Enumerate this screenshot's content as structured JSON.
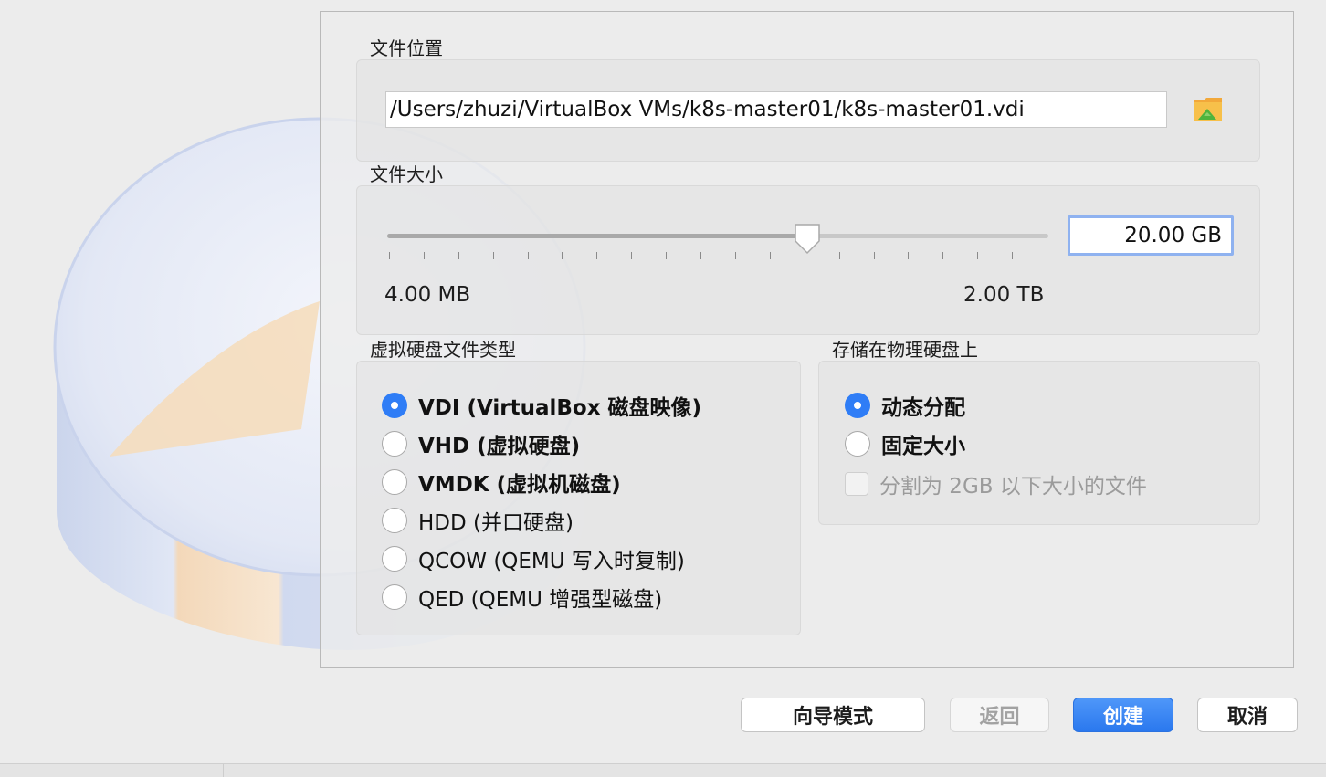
{
  "location": {
    "label": "文件位置",
    "path": "/Users/zhuzi/VirtualBox VMs/k8s-master01/k8s-master01.vdi",
    "browse_icon": "folder-browse-icon"
  },
  "size": {
    "label": "文件大小",
    "value": "20.00 GB",
    "min_label": "4.00 MB",
    "max_label": "2.00 TB",
    "slider_fraction": 0.635
  },
  "disk_type": {
    "label": "虚拟硬盘文件类型",
    "options": [
      {
        "label": "VDI (VirtualBox 磁盘映像)",
        "checked": true
      },
      {
        "label": "VHD (虚拟硬盘)",
        "checked": false
      },
      {
        "label": "VMDK (虚拟机磁盘)",
        "checked": false
      },
      {
        "label": "HDD (并口硬盘)",
        "checked": false
      },
      {
        "label": "QCOW (QEMU 写入时复制)",
        "checked": false
      },
      {
        "label": "QED (QEMU 增强型磁盘)",
        "checked": false
      }
    ]
  },
  "storage": {
    "label": "存储在物理硬盘上",
    "options": [
      {
        "label": "动态分配",
        "checked": true
      },
      {
        "label": "固定大小",
        "checked": false
      }
    ],
    "split_label": "分割为 2GB 以下大小的文件"
  },
  "buttons": {
    "guided": "向导模式",
    "back": "返回",
    "create": "创建",
    "cancel": "取消"
  },
  "colors": {
    "accent": "#2f7df6",
    "focus_ring": "#8fb2f0"
  }
}
